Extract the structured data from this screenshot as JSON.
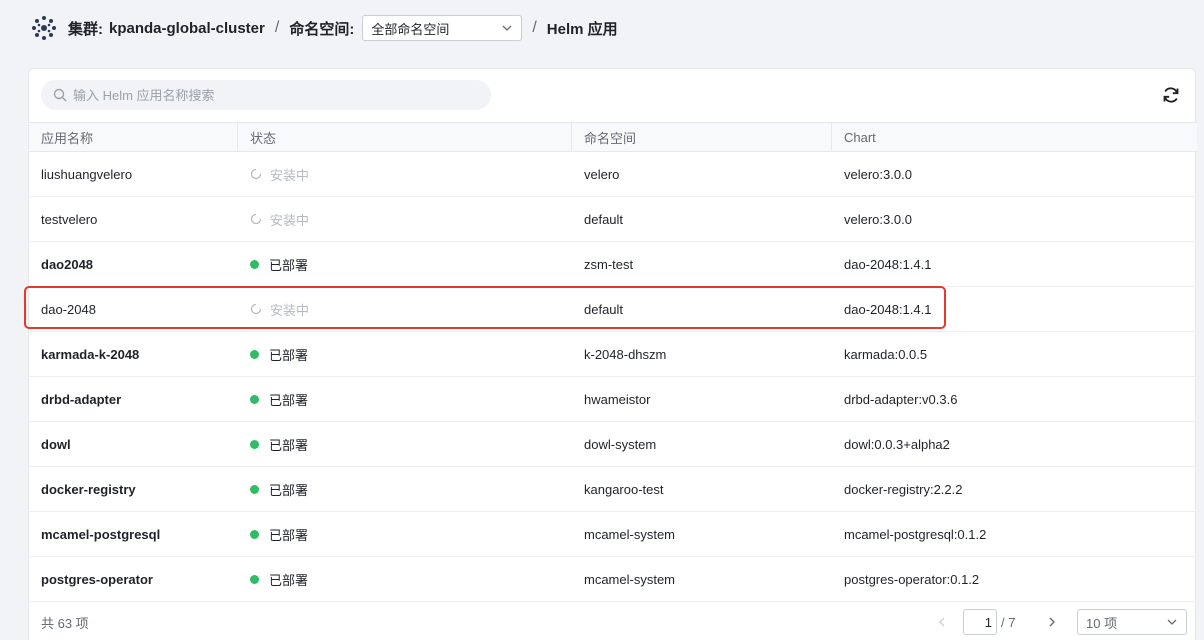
{
  "breadcrumb": {
    "cluster_label": "集群:",
    "cluster_name": "kpanda-global-cluster",
    "separator": "/",
    "namespace_label": "命名空间:",
    "namespace_value": "全部命名空间",
    "page": "Helm 应用"
  },
  "search": {
    "placeholder": "输入 Helm 应用名称搜索"
  },
  "table": {
    "headers": [
      "应用名称",
      "状态",
      "命名空间",
      "Chart"
    ],
    "rows": [
      {
        "name": "liushuangvelero",
        "status": "安装中",
        "status_type": "installing",
        "namespace": "velero",
        "chart": "velero:3.0.0"
      },
      {
        "name": "testvelero",
        "status": "安装中",
        "status_type": "installing",
        "namespace": "default",
        "chart": "velero:3.0.0"
      },
      {
        "name": "dao2048",
        "status": "已部署",
        "status_type": "deployed",
        "namespace": "zsm-test",
        "chart": "dao-2048:1.4.1"
      },
      {
        "name": "dao-2048",
        "status": "安装中",
        "status_type": "installing",
        "namespace": "default",
        "chart": "dao-2048:1.4.1"
      },
      {
        "name": "karmada-k-2048",
        "status": "已部署",
        "status_type": "deployed",
        "namespace": "k-2048-dhszm",
        "chart": "karmada:0.0.5"
      },
      {
        "name": "drbd-adapter",
        "status": "已部署",
        "status_type": "deployed",
        "namespace": "hwameistor",
        "chart": "drbd-adapter:v0.3.6"
      },
      {
        "name": "dowl",
        "status": "已部署",
        "status_type": "deployed",
        "namespace": "dowl-system",
        "chart": "dowl:0.0.3+alpha2"
      },
      {
        "name": "docker-registry",
        "status": "已部署",
        "status_type": "deployed",
        "namespace": "kangaroo-test",
        "chart": "docker-registry:2.2.2"
      },
      {
        "name": "mcamel-postgresql",
        "status": "已部署",
        "status_type": "deployed",
        "namespace": "mcamel-system",
        "chart": "mcamel-postgresql:0.1.2"
      },
      {
        "name": "postgres-operator",
        "status": "已部署",
        "status_type": "deployed",
        "namespace": "mcamel-system",
        "chart": "postgres-operator:0.1.2"
      }
    ]
  },
  "footer": {
    "total": "共 63 项",
    "current_page": "1",
    "page_total": "/ 7",
    "page_size": "10 项"
  },
  "colors": {
    "deployed": "#2ebc65",
    "installing": "#b6bbc3",
    "highlight": "#e23b2e"
  }
}
